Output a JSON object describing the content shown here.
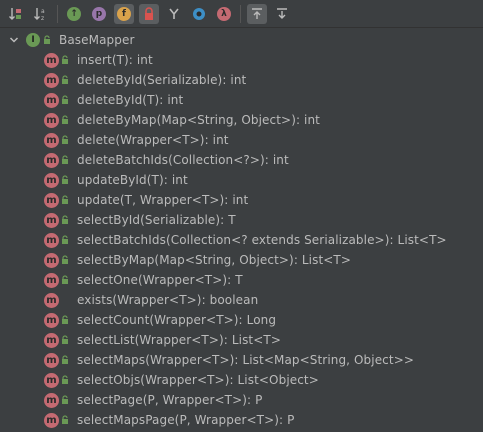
{
  "toolbar": {
    "buttons": [
      {
        "name": "sort-by-visibility-icon"
      },
      {
        "name": "sort-alphabetically-icon"
      },
      {
        "name": "show-inherited-icon",
        "glyph": "↑"
      },
      {
        "name": "show-properties-icon",
        "glyph": "p"
      },
      {
        "name": "show-fields-icon",
        "glyph": "f"
      },
      {
        "name": "show-non-public-icon"
      },
      {
        "name": "show-lambdas-icon"
      },
      {
        "name": "show-anonymous-icon"
      },
      {
        "name": "show-lambda-icon",
        "glyph": "λ"
      },
      {
        "name": "autoscroll-to-source-icon"
      },
      {
        "name": "autoscroll-from-source-icon"
      }
    ]
  },
  "tree": {
    "root": {
      "badge": "I",
      "label": "BaseMapper"
    },
    "methods": [
      {
        "badge": "m",
        "label": "insert(T): int",
        "locked": true
      },
      {
        "badge": "m",
        "label": "deleteById(Serializable): int",
        "locked": true
      },
      {
        "badge": "m",
        "label": "deleteById(T): int",
        "locked": true
      },
      {
        "badge": "m",
        "label": "deleteByMap(Map<String, Object>): int",
        "locked": true
      },
      {
        "badge": "m",
        "label": "delete(Wrapper<T>): int",
        "locked": true
      },
      {
        "badge": "m",
        "label": "deleteBatchIds(Collection<?>): int",
        "locked": true
      },
      {
        "badge": "m",
        "label": "updateById(T): int",
        "locked": true
      },
      {
        "badge": "m",
        "label": "update(T, Wrapper<T>): int",
        "locked": true
      },
      {
        "badge": "m",
        "label": "selectById(Serializable): T",
        "locked": true
      },
      {
        "badge": "m",
        "label": "selectBatchIds(Collection<? extends Serializable>): List<T>",
        "locked": true
      },
      {
        "badge": "m",
        "label": "selectByMap(Map<String, Object>): List<T>",
        "locked": true
      },
      {
        "badge": "m",
        "label": "selectOne(Wrapper<T>): T",
        "locked": true
      },
      {
        "badge": "m",
        "label": "exists(Wrapper<T>): boolean",
        "locked": false
      },
      {
        "badge": "m",
        "label": "selectCount(Wrapper<T>): Long",
        "locked": true
      },
      {
        "badge": "m",
        "label": "selectList(Wrapper<T>): List<T>",
        "locked": true
      },
      {
        "badge": "m",
        "label": "selectMaps(Wrapper<T>): List<Map<String, Object>>",
        "locked": true
      },
      {
        "badge": "m",
        "label": "selectObjs(Wrapper<T>): List<Object>",
        "locked": true
      },
      {
        "badge": "m",
        "label": "selectPage(P, Wrapper<T>): P",
        "locked": true
      },
      {
        "badge": "m",
        "label": "selectMapsPage(P, Wrapper<T>): P",
        "locked": true
      }
    ]
  },
  "colors": {
    "background": "#3c3f41",
    "method_badge": "#c46a72",
    "interface_badge": "#6a9955",
    "lock": "#6a9955",
    "text": "#bbbbbb"
  }
}
